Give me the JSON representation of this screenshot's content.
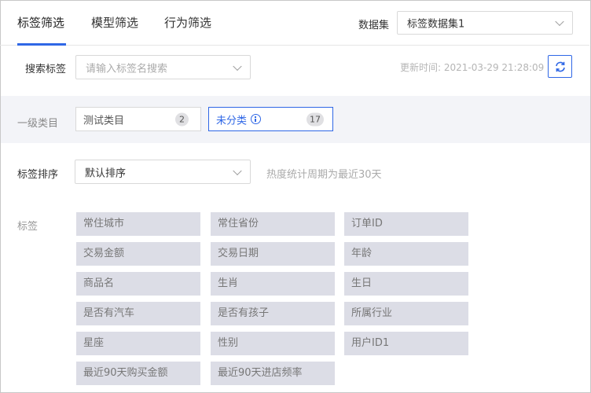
{
  "tabs": [
    {
      "label": "标签筛选",
      "active": true
    },
    {
      "label": "模型筛选",
      "active": false
    },
    {
      "label": "行为筛选",
      "active": false
    }
  ],
  "dataset": {
    "label": "数据集",
    "value": "标签数据集1"
  },
  "search": {
    "label": "搜索标签",
    "placeholder": "请输入标签名搜索"
  },
  "update_time": "更新时间: 2021-03-29 21:28:09",
  "category": {
    "label": "一级类目",
    "items": [
      {
        "name": "测试类目",
        "count": "2",
        "active": false,
        "icon": ""
      },
      {
        "name": "未分类",
        "count": "17",
        "active": true,
        "icon": "info-icon"
      }
    ]
  },
  "sort": {
    "label": "标签排序",
    "value": "默认排序",
    "hint": "热度统计周期为最近30天"
  },
  "tags": {
    "label": "标签",
    "items": [
      "常住城市",
      "常住省份",
      "订单ID",
      "交易金额",
      "交易日期",
      "年龄",
      "商品名",
      "生肖",
      "生日",
      "是否有汽车",
      "是否有孩子",
      "所属行业",
      "星座",
      "性别",
      "用户ID1",
      "最近90天购买金额",
      "最近90天进店频率"
    ]
  },
  "colors": {
    "accent": "#2f67e6",
    "tag_bg": "#dcdde6",
    "band_bg": "#f3f4f8"
  }
}
